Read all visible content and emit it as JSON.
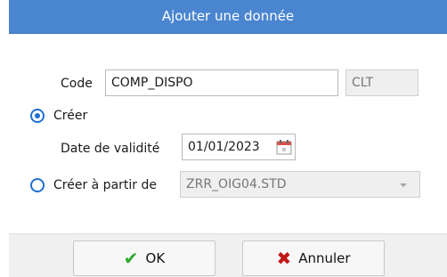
{
  "dialog": {
    "title": "Ajouter une donnée"
  },
  "form": {
    "code_label": "Code",
    "code_value": "COMP_DISPO",
    "code_suffix": "CLT",
    "creer_label": "Créer",
    "creer_checked": true,
    "date_label": "Date de validité",
    "date_value": "01/01/2023",
    "creer_partir_label": "Créer à partir de",
    "creer_partir_checked": false,
    "source_value": "ZRR_OIG04.STD"
  },
  "buttons": {
    "ok_label": "OK",
    "cancel_label": "Annuler"
  },
  "icons": {
    "ok": "check-icon",
    "cancel": "x-icon",
    "date": "calendar-icon",
    "dropdown": "chevron-down-icon"
  },
  "colors": {
    "titlebar": "#4a86d0",
    "radio": "#1f6fd1",
    "ok": "#2eaa2e",
    "cancel": "#c01818"
  }
}
